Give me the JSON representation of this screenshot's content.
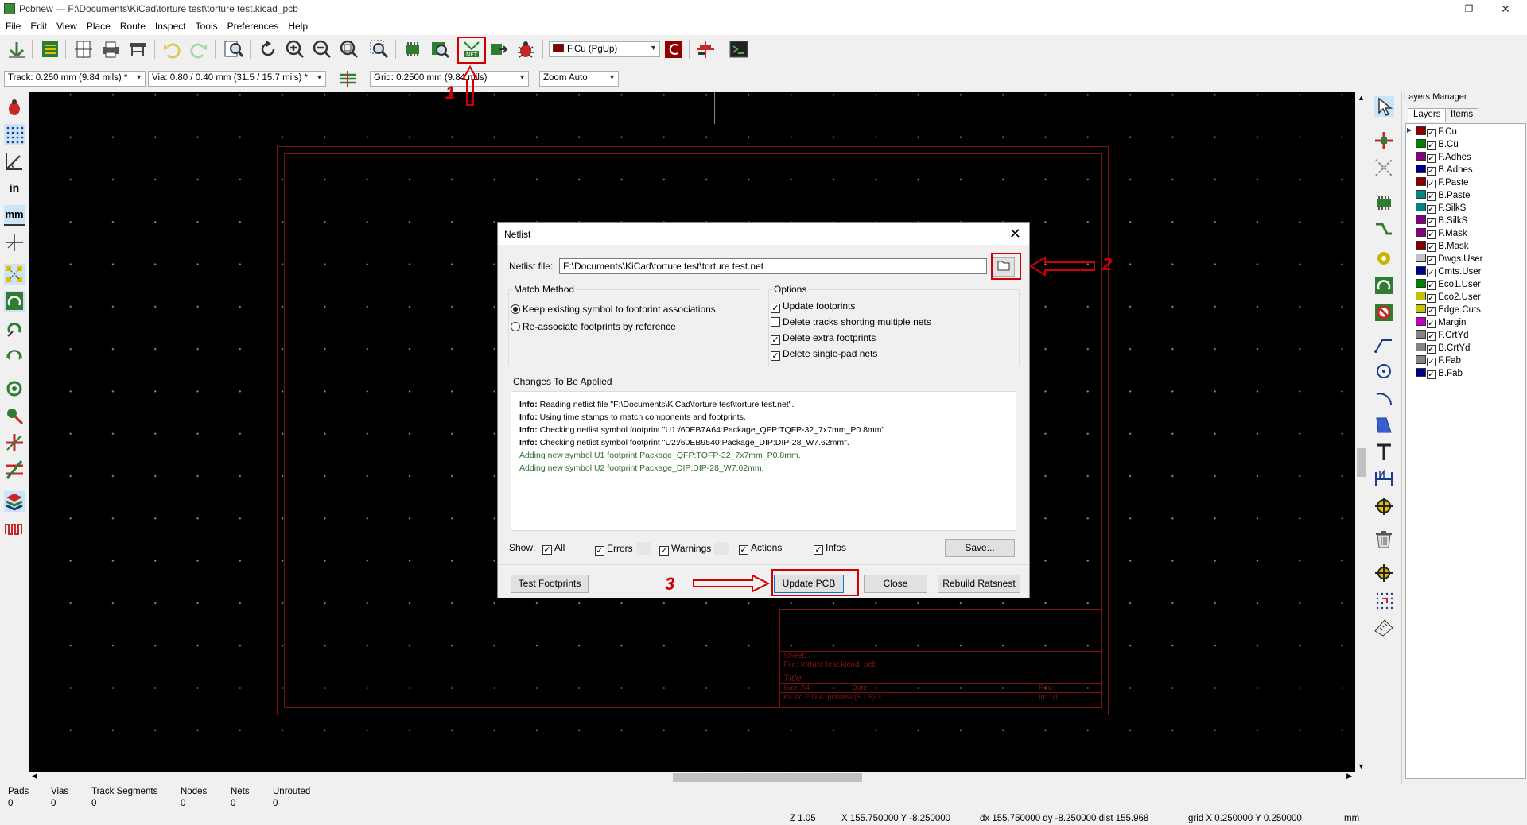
{
  "window": {
    "title": "Pcbnew — F:\\Documents\\KiCad\\torture test\\torture test.kicad_pcb",
    "controls": [
      "–",
      "❐",
      "✕"
    ]
  },
  "menu": [
    "File",
    "Edit",
    "View",
    "Place",
    "Route",
    "Inspect",
    "Tools",
    "Preferences",
    "Help"
  ],
  "toolbar": {
    "layer_select": "F.Cu (PgUp)",
    "track_width": "Track: 0.250 mm (9.84 mils) *",
    "via_size": "Via: 0.80 / 0.40 mm (31.5 / 15.7 mils) *",
    "grid": "Grid: 0.2500 mm (9.84 mils)",
    "zoom": "Zoom Auto",
    "netlist_icon_text": "NET"
  },
  "left_toolbar": {
    "inch_label": "in",
    "mm_label": "mm"
  },
  "layers_manager": {
    "title": "Layers Manager",
    "tabs": [
      "Layers",
      "Items"
    ],
    "layers": [
      {
        "name": "F.Cu",
        "color": "#8c0000",
        "checked": true
      },
      {
        "name": "B.Cu",
        "color": "#008400",
        "checked": true
      },
      {
        "name": "F.Adhes",
        "color": "#840084",
        "checked": true
      },
      {
        "name": "B.Adhes",
        "color": "#000084",
        "checked": true
      },
      {
        "name": "F.Paste",
        "color": "#840000",
        "checked": true
      },
      {
        "name": "B.Paste",
        "color": "#008484",
        "checked": true
      },
      {
        "name": "F.SilkS",
        "color": "#008484",
        "checked": true
      },
      {
        "name": "B.SilkS",
        "color": "#840084",
        "checked": true
      },
      {
        "name": "F.Mask",
        "color": "#840084",
        "checked": true
      },
      {
        "name": "B.Mask",
        "color": "#840000",
        "checked": true
      },
      {
        "name": "Dwgs.User",
        "color": "#c2c2c2",
        "checked": true
      },
      {
        "name": "Cmts.User",
        "color": "#000084",
        "checked": true
      },
      {
        "name": "Eco1.User",
        "color": "#008400",
        "checked": true
      },
      {
        "name": "Eco2.User",
        "color": "#c2c200",
        "checked": true
      },
      {
        "name": "Edge.Cuts",
        "color": "#c2c200",
        "checked": true
      },
      {
        "name": "Margin",
        "color": "#c200c2",
        "checked": true
      },
      {
        "name": "F.CrtYd",
        "color": "#848484",
        "checked": true
      },
      {
        "name": "B.CrtYd",
        "color": "#848484",
        "checked": true
      },
      {
        "name": "F.Fab",
        "color": "#848484",
        "checked": true
      },
      {
        "name": "B.Fab",
        "color": "#000084",
        "checked": true
      }
    ]
  },
  "status": {
    "pads_label": "Pads",
    "pads": "0",
    "vias_label": "Vias",
    "vias": "0",
    "tracks_label": "Track Segments",
    "tracks": "0",
    "nodes_label": "Nodes",
    "nodes": "0",
    "nets_label": "Nets",
    "nets": "0",
    "unrouted_label": "Unrouted",
    "unrouted": "0",
    "zoom": "Z 1.05",
    "xy": "X 155.750000  Y -8.250000",
    "delta": "dx 155.750000  dy -8.250000  dist 155.968",
    "grid": "grid X 0.250000  Y 0.250000",
    "units": "mm"
  },
  "titleblock": {
    "sheet": "Sheet: /",
    "file": "File: torture test.kicad_pcb",
    "title": "Title:",
    "size": "Size: A4",
    "date": "Date:",
    "rev": "Rev:",
    "kicad": "KiCad E.D.A.  pcbnew (5.1.5)-3",
    "id": "Id: 1/1"
  },
  "dialog": {
    "title": "Netlist",
    "netlist_label": "Netlist file:",
    "netlist_path": "F:\\Documents\\KiCad\\torture test\\torture test.net",
    "match_method": "Match Method",
    "radio_keep": "Keep existing symbol to footprint associations",
    "radio_reassoc": "Re-associate footprints by reference",
    "options": "Options",
    "opt_update": "Update footprints",
    "opt_delete_tracks": "Delete tracks shorting multiple nets",
    "opt_delete_extra": "Delete extra footprints",
    "opt_delete_single": "Delete single-pad nets",
    "changes": "Changes To Be Applied",
    "messages": [
      {
        "prefix": "Info:",
        "text": " Reading netlist file \"F:\\Documents\\KiCad\\torture test\\torture test.net\"."
      },
      {
        "prefix": "Info:",
        "text": " Using time stamps to match components and footprints."
      },
      {
        "prefix": "Info:",
        "text": " Checking netlist symbol footprint \"U1:/60EB7A64:Package_QFP:TQFP-32_7x7mm_P0.8mm\"."
      },
      {
        "prefix": "Info:",
        "text": " Checking netlist symbol footprint \"U2:/60EB9540:Package_DIP:DIP-28_W7.62mm\"."
      },
      {
        "prefix": "",
        "text": "Adding new symbol U1 footprint Package_QFP:TQFP-32_7x7mm_P0.8mm."
      },
      {
        "prefix": "",
        "text": "Adding new symbol U2 footprint Package_DIP:DIP-28_W7.62mm."
      }
    ],
    "show_label": "Show:",
    "filter_all": "All",
    "filter_errors": "Errors",
    "filter_warnings": "Warnings",
    "filter_actions": "Actions",
    "filter_infos": "Infos",
    "save_btn": "Save...",
    "test_btn": "Test Footprints",
    "update_btn": "Update PCB",
    "close_btn": "Close",
    "rebuild_btn": "Rebuild Ratsnest"
  },
  "annotations": {
    "one": "1",
    "two": "2",
    "three": "3",
    "color": "#d00000"
  }
}
